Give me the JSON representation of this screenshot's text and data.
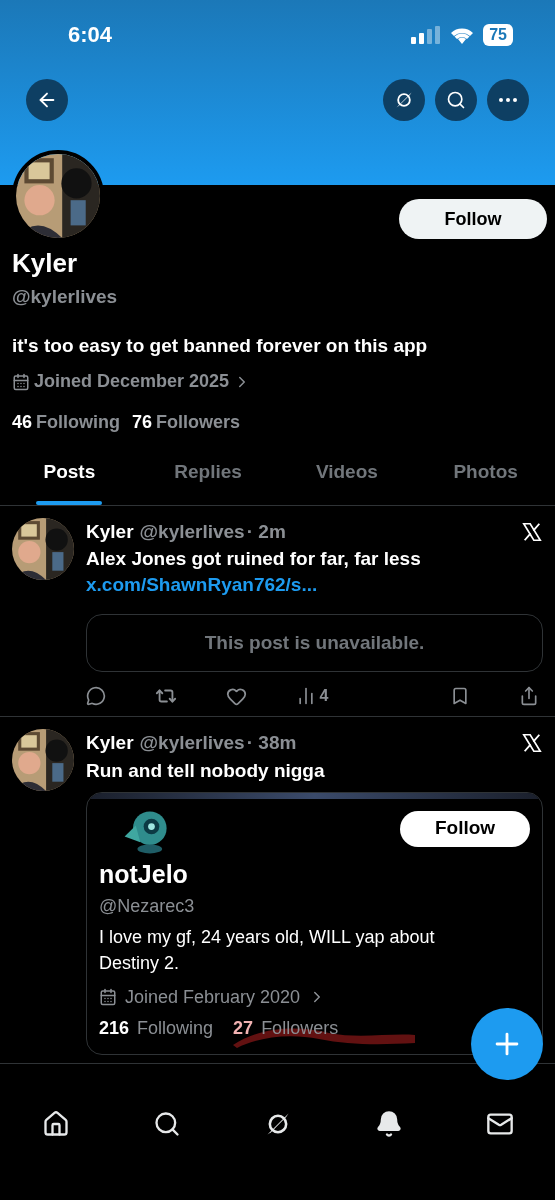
{
  "status_bar": {
    "time": "6:04",
    "battery": "75"
  },
  "profile": {
    "name": "Kyler",
    "handle": "@kylerlives",
    "bio": "it's too easy to get banned forever on this app",
    "joined": "Joined December 2025",
    "following_count": "46",
    "following_label": "Following",
    "followers_count": "76",
    "followers_label": "Followers",
    "follow_button": "Follow"
  },
  "tabs": [
    {
      "label": "Posts",
      "selected": true
    },
    {
      "label": "Replies",
      "selected": false
    },
    {
      "label": "Videos",
      "selected": false
    },
    {
      "label": "Photos",
      "selected": false
    }
  ],
  "posts": [
    {
      "kind": "link",
      "name": "Kyler",
      "handle": "@kylerlives",
      "time": "· 2m",
      "text": "Alex Jones got ruined for far, far less",
      "link": "x.com/ShawnRyan762/s...",
      "unavailable": "This post is unavailable.",
      "views": "4"
    },
    {
      "kind": "profile",
      "name": "Kyler",
      "handle": "@kylerlives",
      "time": "· 38m",
      "text": "Run and tell nobody nigga",
      "card": {
        "name": "notJelo",
        "handle": "@Nezarec3",
        "bio": "I love my gf, 24 years old, WILL yap about Destiny 2.",
        "joined": "Joined February 2020",
        "following_count": "216",
        "following_label": "Following",
        "followers_count": "27",
        "followers_label": "Followers",
        "follow_button": "Follow"
      }
    }
  ]
}
